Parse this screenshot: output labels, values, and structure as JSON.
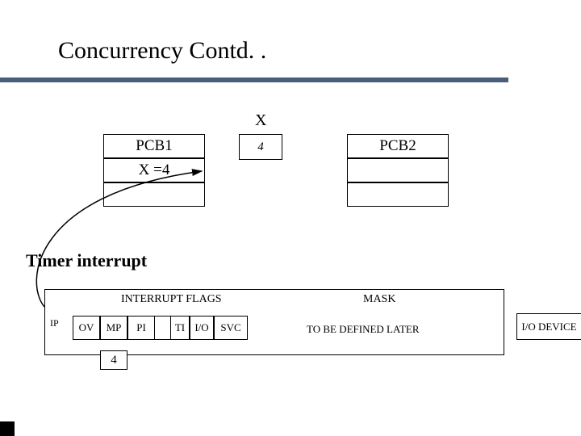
{
  "title": "Concurrency Contd. .",
  "x_label": "X",
  "pcb1": {
    "header": "PCB1",
    "row1": "X =4"
  },
  "pcb2": {
    "header": "PCB2"
  },
  "x_box_value": "4",
  "timer_label": "Timer interrupt",
  "interrupt": {
    "flags_header": "INTERRUPT FLAGS",
    "mask_header": "MASK",
    "ip_label": "IP",
    "flags": {
      "ov": "OV",
      "mp": "MP",
      "pi": "PI",
      "ti": "TI",
      "io": "I/O",
      "svc": "SVC"
    },
    "mp_value": "4",
    "mask_text": "TO BE DEFINED LATER"
  },
  "io_device": "I/O DEVICE"
}
